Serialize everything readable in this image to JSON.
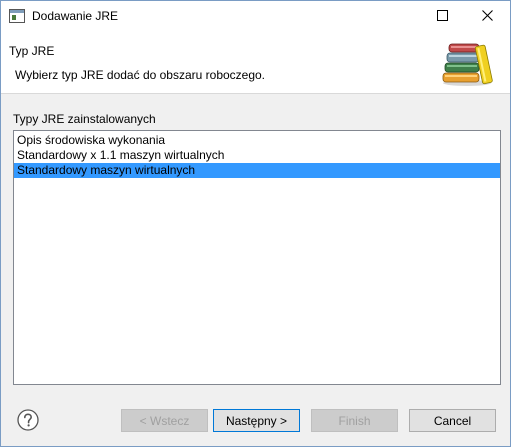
{
  "window": {
    "title": "Dodawanie JRE"
  },
  "header": {
    "title": "Typ JRE",
    "description": "Wybierz typ JRE dodać do obszaru roboczego."
  },
  "jre_types": {
    "label": "Typy JRE zainstalowanych",
    "items": [
      {
        "label": "Opis środowiska wykonania",
        "selected": false
      },
      {
        "label": "Standardowy x 1.1 maszyn wirtualnych",
        "selected": false
      },
      {
        "label": "Standardowy maszyn wirtualnych",
        "selected": true
      }
    ]
  },
  "buttons": {
    "back": "< Wstecz",
    "next": "Następny >",
    "finish": "Finish",
    "cancel": "Cancel"
  },
  "colors": {
    "selection": "#3399ff",
    "border_accent": "#0078d7"
  }
}
